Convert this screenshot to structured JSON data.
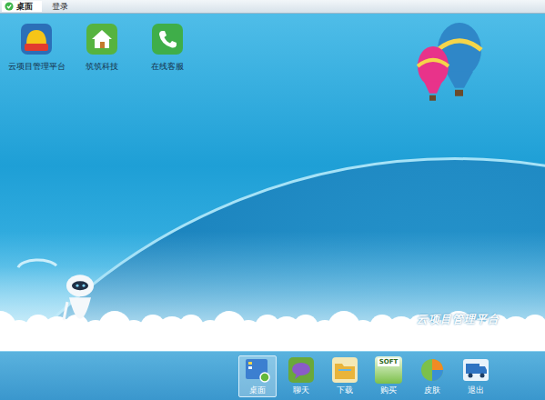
{
  "topbar": {
    "tabs": [
      {
        "label": "桌面",
        "selected": true
      },
      {
        "label": "登录",
        "selected": false
      }
    ]
  },
  "desktop_icons": [
    {
      "label": "云项目管理平台"
    },
    {
      "label": "筑筑科技"
    },
    {
      "label": "在线客服"
    }
  ],
  "wallpaper": {
    "caption": "云项目管理平台"
  },
  "taskbar": {
    "items": [
      {
        "label": "桌面",
        "selected": true,
        "badge": ""
      },
      {
        "label": "聊天",
        "selected": false,
        "badge": ""
      },
      {
        "label": "下载",
        "selected": false,
        "badge": ""
      },
      {
        "label": "购买",
        "selected": false,
        "badge": "SOFT"
      },
      {
        "label": "皮肤",
        "selected": false,
        "badge": ""
      },
      {
        "label": "退出",
        "selected": false,
        "badge": ""
      }
    ]
  }
}
